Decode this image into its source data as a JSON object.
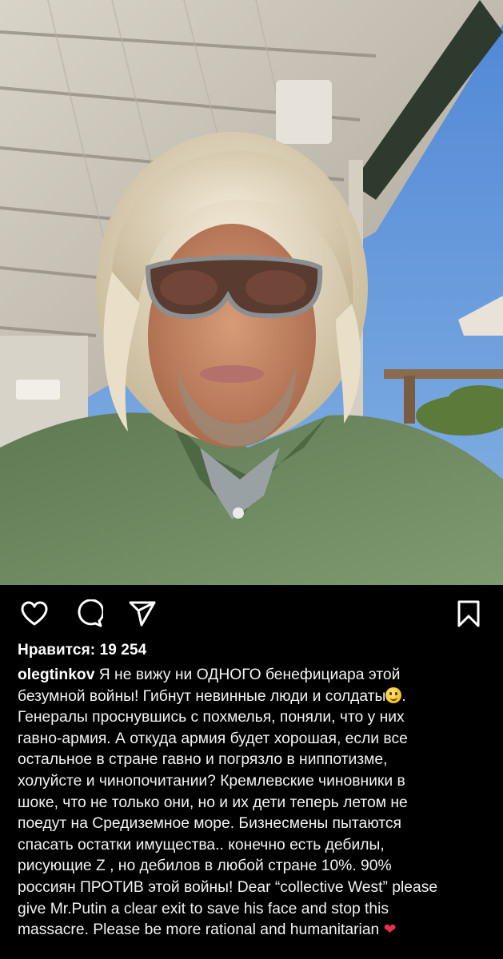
{
  "post": {
    "photo_alt": "",
    "actions": {
      "like_icon": "heart-icon",
      "comment_icon": "comment-icon",
      "share_icon": "share-icon",
      "save_icon": "bookmark-icon"
    },
    "likes_label": "Нравится: 19 254",
    "username": "olegtinkov",
    "caption_lines": [
      " Я не вижу ни ОДНОГО бенефициара этой",
      "безумной войны! Гибнут невинные люди и солдаты",
      "Генералы проснувшись с похмелья, поняли, что у них",
      "гавно-армия. А откуда армия будет хорошая, если все",
      "остальное в стране  гавно и погрязло в ниппотизме,",
      "холуйсте и чинопочитании?  Кремлевские чиновники в",
      "шоке, что не только они, но и их дети теперь летом не",
      "поедут на Средиземное море. Бизнесмены пытаются",
      "спасать остатки имущества.. конечно есть дебилы,",
      "рисующие Z , но дебилов в любой стране 10%. 90%",
      "россиян ПРОТИВ этой войны! Dear “collective West” please",
      "give Mr.Putin a clear exit to save his face and stop this",
      "massacre. Please be more rational and humanitarian "
    ],
    "caption_line2_tail": ".",
    "emoji": {
      "slight_smile": "slightly-smiling-face-emoji",
      "heart": "❤"
    },
    "colors": {
      "background": "#000000",
      "text": "#ffffff",
      "heart": "#e8304a"
    }
  }
}
